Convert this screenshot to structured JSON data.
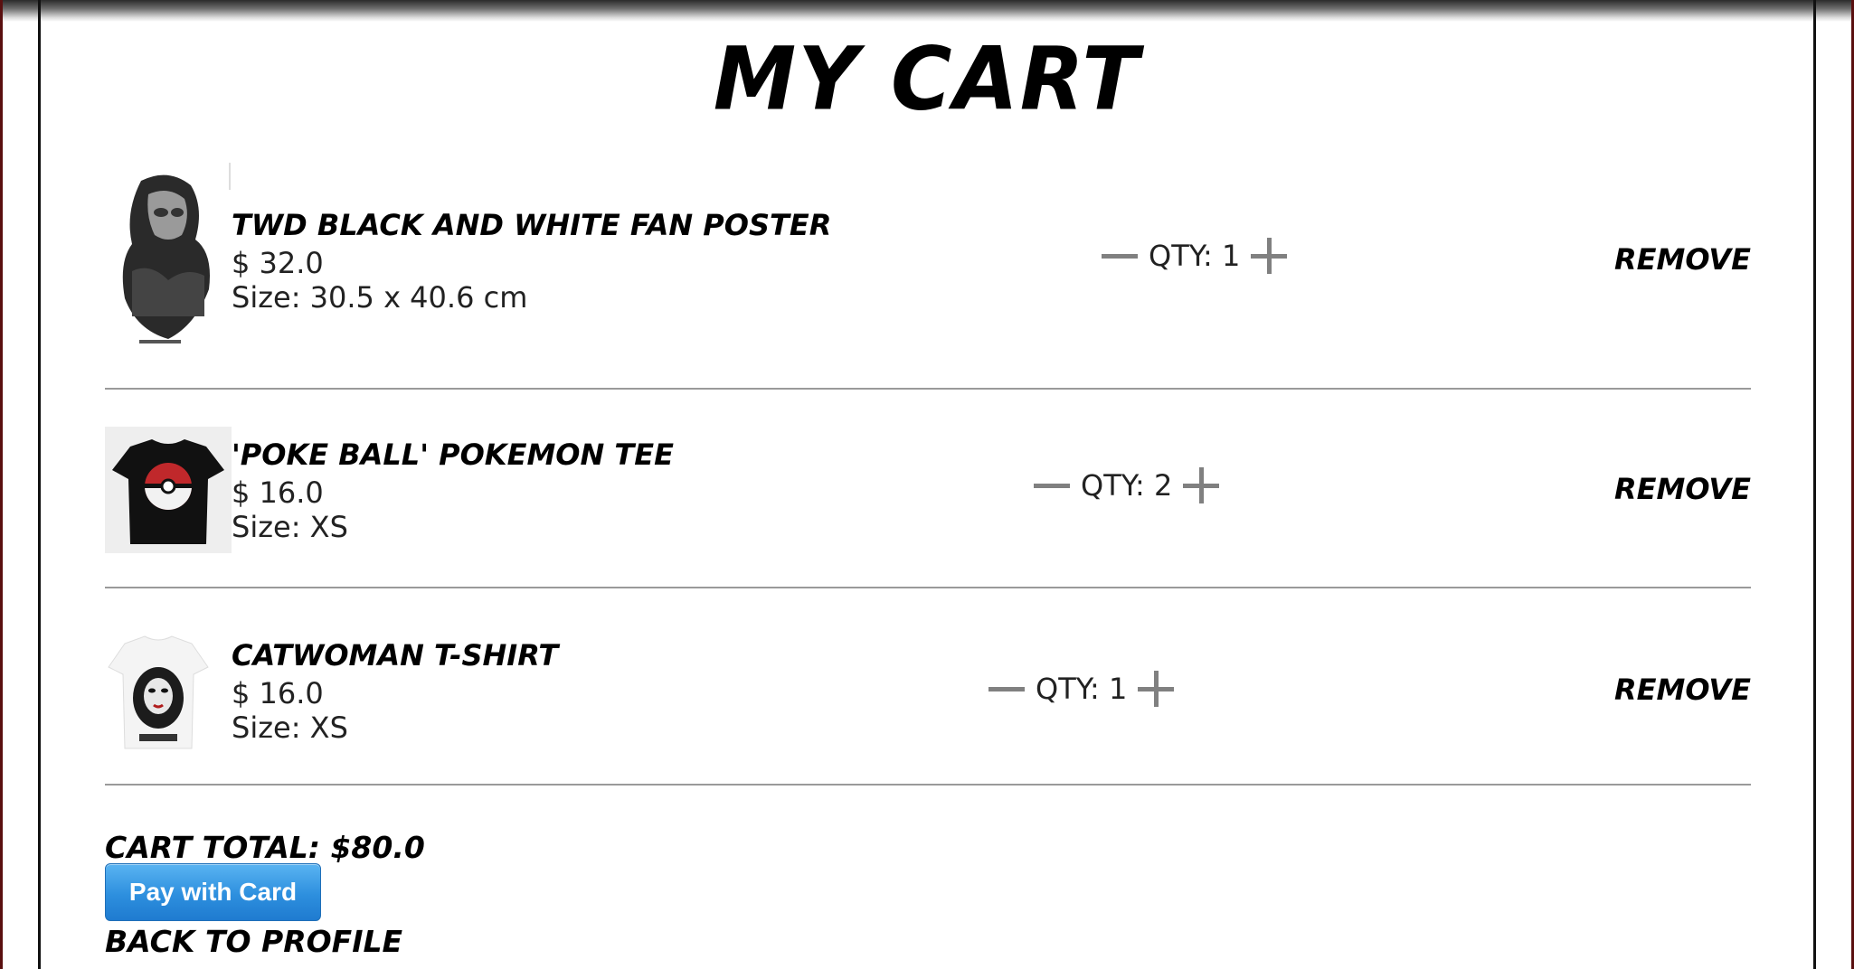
{
  "page": {
    "title": "MY CART"
  },
  "items": [
    {
      "name": "TWD BLACK AND WHITE FAN POSTER",
      "price": "$ 32.0",
      "size": "Size: 30.5 x 40.6 cm",
      "qty_label": "QTY: 1",
      "remove_label": "REMOVE",
      "image": "twd-poster-image"
    },
    {
      "name": "'POKE BALL' POKEMON TEE",
      "price": "$ 16.0",
      "size": "Size: XS",
      "qty_label": "QTY: 2",
      "remove_label": "REMOVE",
      "image": "pokemon-tee-image"
    },
    {
      "name": "CATWOMAN T-SHIRT",
      "price": "$ 16.0",
      "size": "Size: XS",
      "qty_label": "QTY: 1",
      "remove_label": "REMOVE",
      "image": "catwoman-tshirt-image"
    }
  ],
  "footer": {
    "cart_total": "CART TOTAL: $80.0",
    "pay_button": "Pay with Card",
    "back_link": "BACK TO PROFILE"
  },
  "colors": {
    "pay_button": "#2d8fde",
    "qty_icons": "#808080",
    "divider": "#9a9a9a"
  }
}
